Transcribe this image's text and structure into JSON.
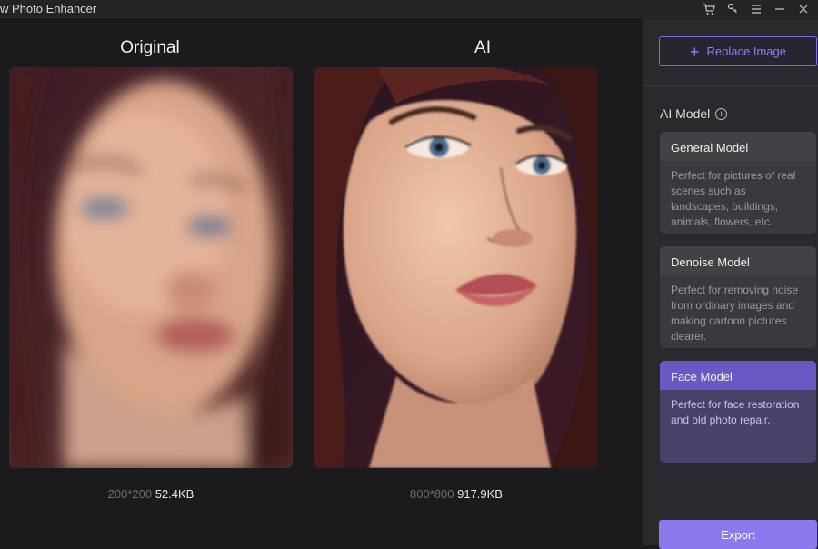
{
  "app": {
    "title": "w Photo Enhancer"
  },
  "titlebar": {
    "icons": [
      "cart-icon",
      "key-icon",
      "menu-icon",
      "minimize-icon",
      "close-icon"
    ]
  },
  "comparison": {
    "original": {
      "label": "Original",
      "resolution": "200*200",
      "size": "52.4KB"
    },
    "ai": {
      "label": "AI",
      "resolution": "800*800",
      "size": "917.9KB"
    }
  },
  "sidebar": {
    "replace_label": "Replace Image",
    "ai_model_label": "AI Model",
    "models": [
      {
        "title": "General Model",
        "desc": "Perfect for pictures of real scenes such as landscapes, buildings, animals, flowers, etc."
      },
      {
        "title": "Denoise Model",
        "desc": "Perfect for removing noise from ordinary images and making cartoon pictures clearer."
      },
      {
        "title": "Face Model",
        "desc": "Perfect for face restoration and old photo repair."
      }
    ],
    "selected_model": "Face Model",
    "export_label": "Export"
  },
  "colors": {
    "accent": "#8b79ee",
    "selected_card": "#4a4168",
    "background": "#1b1b1d"
  }
}
